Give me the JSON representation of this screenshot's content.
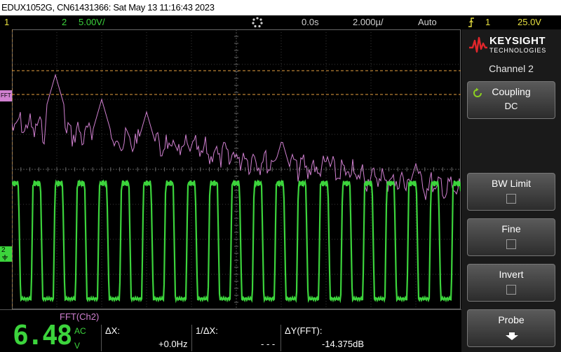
{
  "title_bar": {
    "text": "EDUX1052G, CN61431366: Sat May 13 11:16:43 2023"
  },
  "status_bar": {
    "ch1_number": "1",
    "ch2_number": "2",
    "ch2_scale": "5.00V/",
    "time_offset": "0.0s",
    "time_scale": "2.000µ/",
    "trigger_mode": "Auto",
    "trigger_source": "1",
    "trigger_level": "25.0V"
  },
  "markers": {
    "fft_marker": "FFT",
    "ch2_marker": "2"
  },
  "side_panel": {
    "brand_name": "KEYSIGHT",
    "brand_sub": "TECHNOLOGIES",
    "menu_title": "Channel 2",
    "softkeys": [
      {
        "label": "Coupling",
        "value": "DC"
      },
      {
        "label": "BW Limit"
      },
      {
        "label": "Fine"
      },
      {
        "label": "Invert"
      },
      {
        "label": "Probe"
      }
    ]
  },
  "bottom": {
    "fft_label": "FFT(Ch2)",
    "big_value": "6.48",
    "ac_label": "AC",
    "v_label": "V",
    "dx_label": "ΔX:",
    "dx_value": "+0.0Hz",
    "inv_dx_label": "1/ΔX:",
    "inv_dx_value": "- - -",
    "dy_label": "ΔY(FFT):",
    "dy_value": "-14.375dB"
  },
  "colors": {
    "ch1": "#e8e040",
    "ch2": "#3cd43c",
    "fft": "#d080d0",
    "cursor": "#e8a040"
  }
}
